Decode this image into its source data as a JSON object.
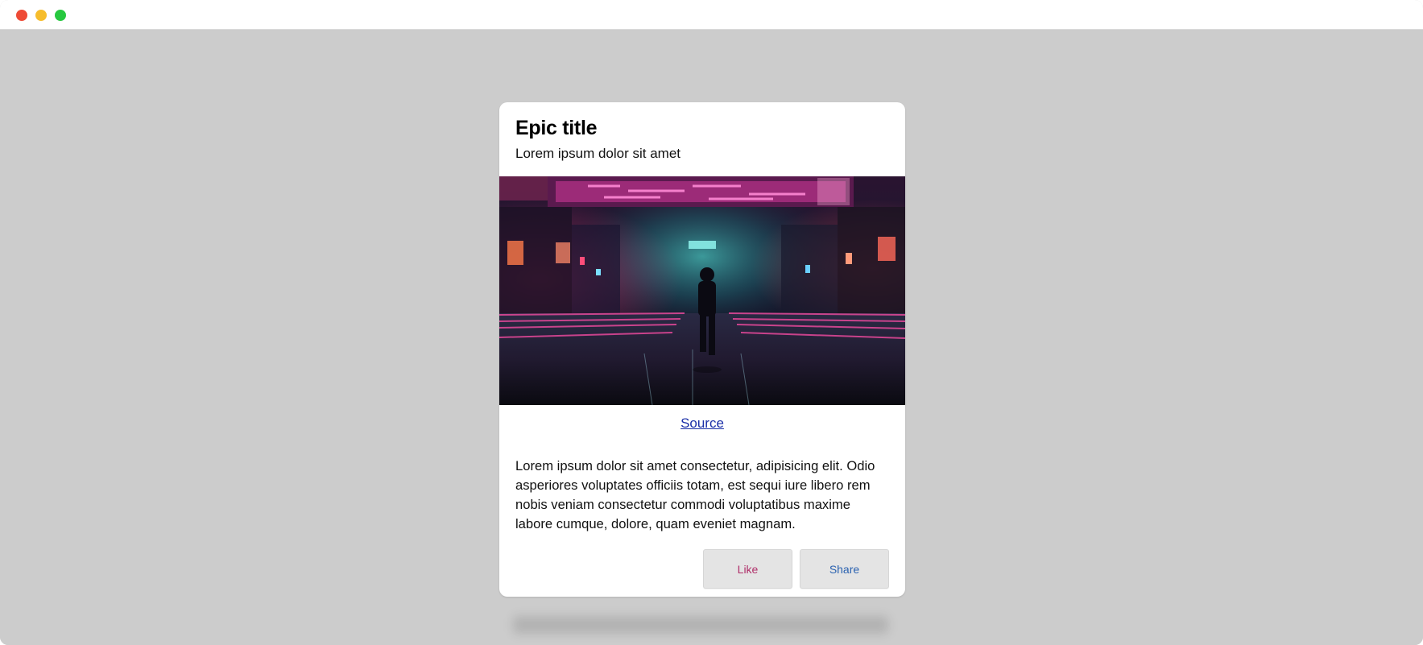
{
  "window": {
    "controls": [
      "close",
      "minimize",
      "zoom"
    ]
  },
  "card": {
    "title": "Epic title",
    "subtitle": "Lorem ipsum dolor sit amet",
    "image": {
      "icon": "cyberpunk-street-image"
    },
    "source_link": "Source",
    "body": "Lorem ipsum dolor sit amet consectetur, adipisicing elit. Odio asperiores voluptates officiis totam, est sequi iure libero rem nobis veniam consectetur commodi voluptatibus maxime labore cumque, dolore, quam eveniet magnam.",
    "buttons": {
      "like_label": "Like",
      "share_label": "Share"
    }
  },
  "colors": {
    "background": "#cccccc",
    "card": "#ffffff",
    "link": "#1a2fa8",
    "like": "#b0306a",
    "share": "#2b62b0",
    "button_bg": "#e4e4e4"
  }
}
